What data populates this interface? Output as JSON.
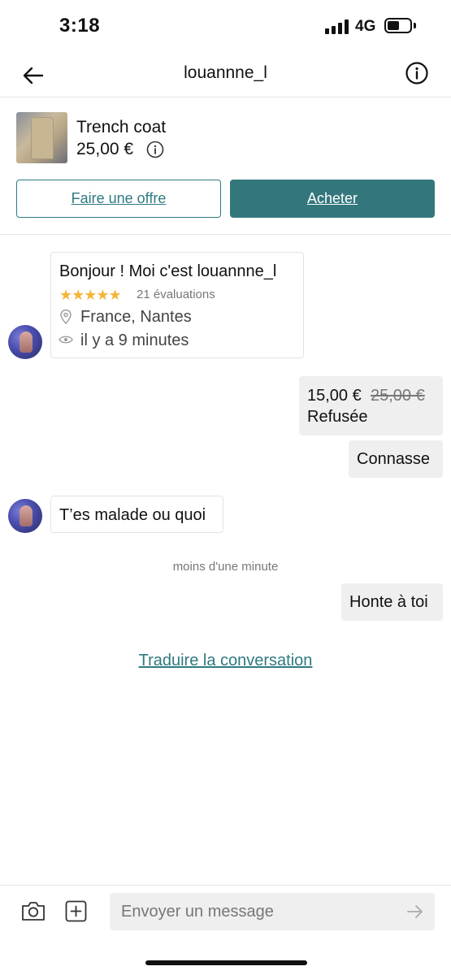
{
  "status_bar": {
    "time": "3:18",
    "network": "4G"
  },
  "header": {
    "username": "louannne_l",
    "back_icon": "arrow-left-icon",
    "info_icon": "info-circle-icon"
  },
  "item": {
    "title": "Trench coat",
    "price": "25,00 €",
    "price_info_icon": "info-circle-icon",
    "offer_button": "Faire une offre",
    "buy_button": "Acheter"
  },
  "profile_card": {
    "greeting": "Bonjour ! Moi c'est louannne_l",
    "stars": "★★★★★",
    "rating": "21 évaluations",
    "location": "France, Nantes",
    "last_seen": "il y a 9 minutes"
  },
  "messages": {
    "offer": {
      "new_price": "15,00 €",
      "old_price": "25,00 €",
      "status": "Refusée"
    },
    "out_1": "Connasse",
    "in_1": "T’es malade ou quoi",
    "timestamp": "moins d'une minute",
    "out_2": "Honte à toi"
  },
  "translate_link": "Traduire la conversation",
  "composer": {
    "placeholder": "Envoyer un message"
  },
  "colors": {
    "accent": "#33777d",
    "link": "#2e7a81",
    "stars": "#f3b63a",
    "bubble": "#efefef"
  }
}
